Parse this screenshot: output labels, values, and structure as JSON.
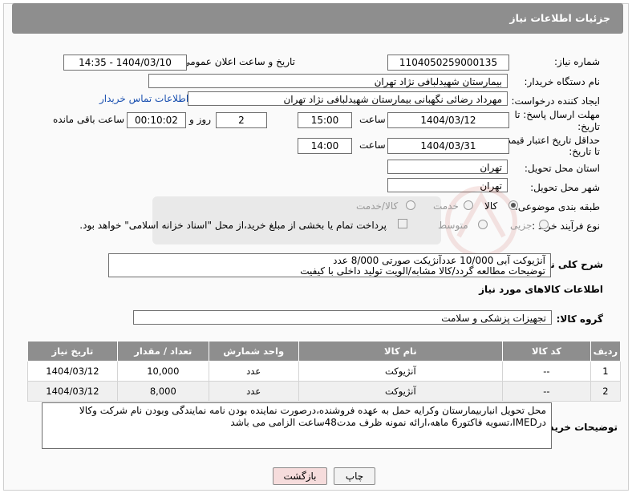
{
  "header": {
    "title": "جزئیات اطلاعات نیاز"
  },
  "form": {
    "need_number_label": "شماره نیاز:",
    "need_number": "1104050259000135",
    "announce_label": "تاریخ و ساعت اعلان عمومی:",
    "announce_value": "1404/03/10 - 14:35",
    "buyer_org_label": "نام دستگاه خریدار:",
    "buyer_org": "بیمارستان شهیدلبافی نژاد تهران",
    "creator_label": "ایجاد کننده درخواست:",
    "creator": "مهرداد رضائی نگهبانی بیمارستان شهیدلبافی نژاد تهران",
    "contact_link": "اطلاعات تماس خریدار",
    "deadline_label_1": "مهلت ارسال پاسخ: تا",
    "deadline_label_2": "تاریخ:",
    "deadline_date": "1404/03/12",
    "time_label": "ساعت",
    "deadline_time": "15:00",
    "days_value": "2",
    "days_label": "روز و",
    "remaining_value": "00:10:02",
    "remaining_label": "ساعت باقی مانده",
    "validity_label_1": "حداقل تاریخ اعتبار قیمت:",
    "validity_label_2": "تا تاریخ:",
    "validity_date": "1404/03/31",
    "validity_time": "14:00",
    "province_label": "استان محل تحویل:",
    "province": "تهران",
    "city_label": "شهر محل تحویل:",
    "city": "تهران",
    "category_label": "طبقه بندی موضوعی:",
    "category_options": [
      "کالا",
      "خدمت",
      "کالا/خدمت"
    ],
    "category_selected": "کالا",
    "process_label": "نوع فرآیند خرید :",
    "process_options": [
      "جزیی",
      "متوسط"
    ],
    "payment_text": "پرداخت تمام یا بخشی از مبلغ خرید،از محل \"اسناد خزانه اسلامی\" خواهد بود."
  },
  "need": {
    "label": "شرح کلی نیاز:",
    "line1": "آنژیوکت آبی 10/000 عددآنژیکت صورتی 8/000 عدد",
    "line2": "توضیحات مطالعه گردد/کالا مشابه/الویت تولید داخلی با کیفیت"
  },
  "goods": {
    "section_title": "اطلاعات کالاهای مورد نیاز",
    "group_label": "گروه کالا:",
    "group_value": "تجهیزات پزشکی و سلامت",
    "columns": [
      "ردیف",
      "کد کالا",
      "نام کالا",
      "واحد شمارش",
      "تعداد / مقدار",
      "تاریخ نیاز"
    ],
    "rows": [
      [
        "1",
        "--",
        "آنژیوکت",
        "عدد",
        "10,000",
        "1404/03/12"
      ],
      [
        "2",
        "--",
        "آنژیوکت",
        "عدد",
        "8,000",
        "1404/03/12"
      ]
    ]
  },
  "buyer_notes": {
    "label": "توضیحات خریدار:",
    "text": "محل تحویل انباربیمارستان وکرایه حمل به عهده فروشنده،درصورت نماینده بودن نامه نمایندگی وبودن نام شرکت وکالا درIMED،تسویه فاکتور6 ماهه،ارائه نمونه ظرف مدت48ساعت الزامی می باشد"
  },
  "buttons": {
    "print": "چاپ",
    "back": "بازگشت"
  },
  "colors": {
    "header_bg": "#8e8e8e",
    "link": "#1a50b0",
    "back_btn_bg": "#f6dcdc"
  }
}
